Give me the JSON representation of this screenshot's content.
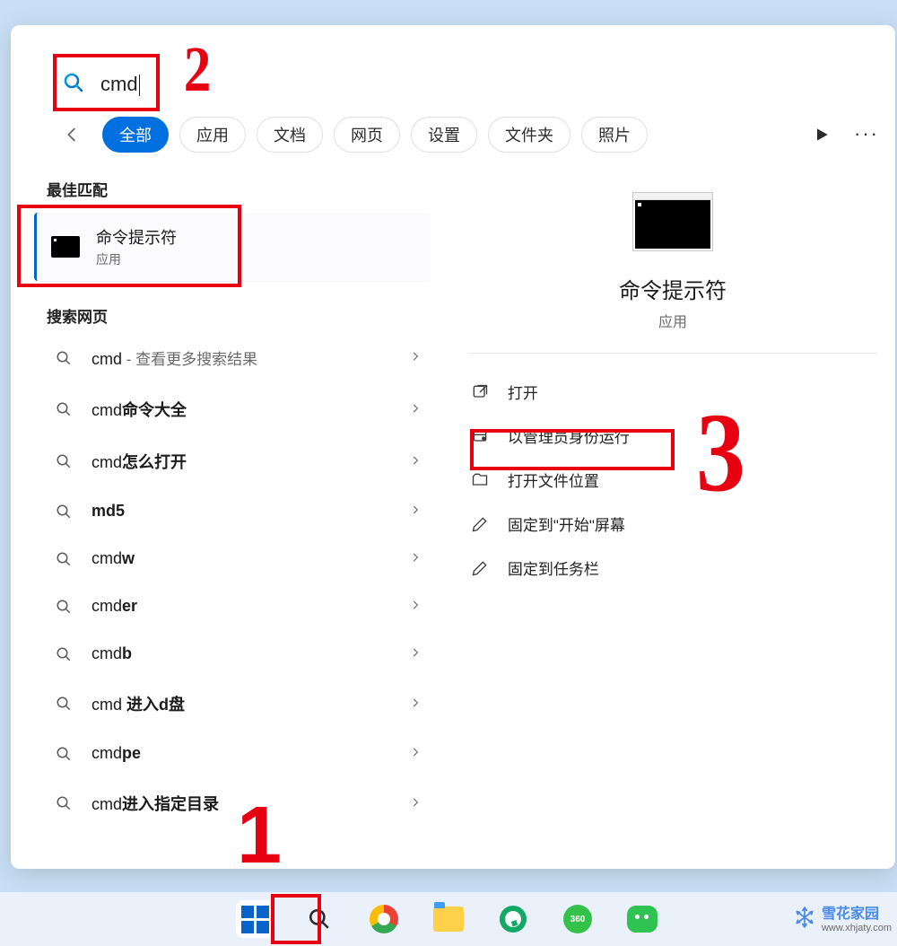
{
  "search": {
    "value": "cmd"
  },
  "tabs": [
    "全部",
    "应用",
    "文档",
    "网页",
    "设置",
    "文件夹",
    "照片"
  ],
  "sections": {
    "best": "最佳匹配",
    "web": "搜索网页"
  },
  "best_match": {
    "title": "命令提示符",
    "subtitle": "应用"
  },
  "web_results": [
    {
      "prefix": "cmd",
      "suffix_light": " - 查看更多搜索结果",
      "bold_tail": ""
    },
    {
      "prefix": "cmd",
      "suffix_light": "",
      "bold_tail": "命令大全"
    },
    {
      "prefix": "cmd",
      "suffix_light": "",
      "bold_tail": "怎么打开"
    },
    {
      "prefix": "",
      "suffix_light": "",
      "bold_tail": "md5"
    },
    {
      "prefix": "cmd",
      "suffix_light": "",
      "bold_tail": "w"
    },
    {
      "prefix": "cmd",
      "suffix_light": "",
      "bold_tail": "er"
    },
    {
      "prefix": "cmd",
      "suffix_light": "",
      "bold_tail": "b"
    },
    {
      "prefix": "cmd ",
      "suffix_light": "",
      "bold_tail": "进入d盘"
    },
    {
      "prefix": "cmd",
      "suffix_light": "",
      "bold_tail": "pe"
    },
    {
      "prefix": "cmd",
      "suffix_light": "",
      "bold_tail": "进入指定目录"
    }
  ],
  "preview": {
    "title": "命令提示符",
    "subtitle": "应用"
  },
  "actions": [
    "打开",
    "以管理员身份运行",
    "打开文件位置",
    "固定到\"开始\"屏幕",
    "固定到任务栏"
  ],
  "annotations": {
    "a1": "1",
    "a2": "2",
    "a3": "3"
  },
  "watermark": {
    "brand": "雪花家园",
    "url": "www.xhjaty.com"
  },
  "taskbar_icons": [
    "start",
    "search",
    "chrome",
    "explorer",
    "ie",
    "360",
    "wechat"
  ]
}
